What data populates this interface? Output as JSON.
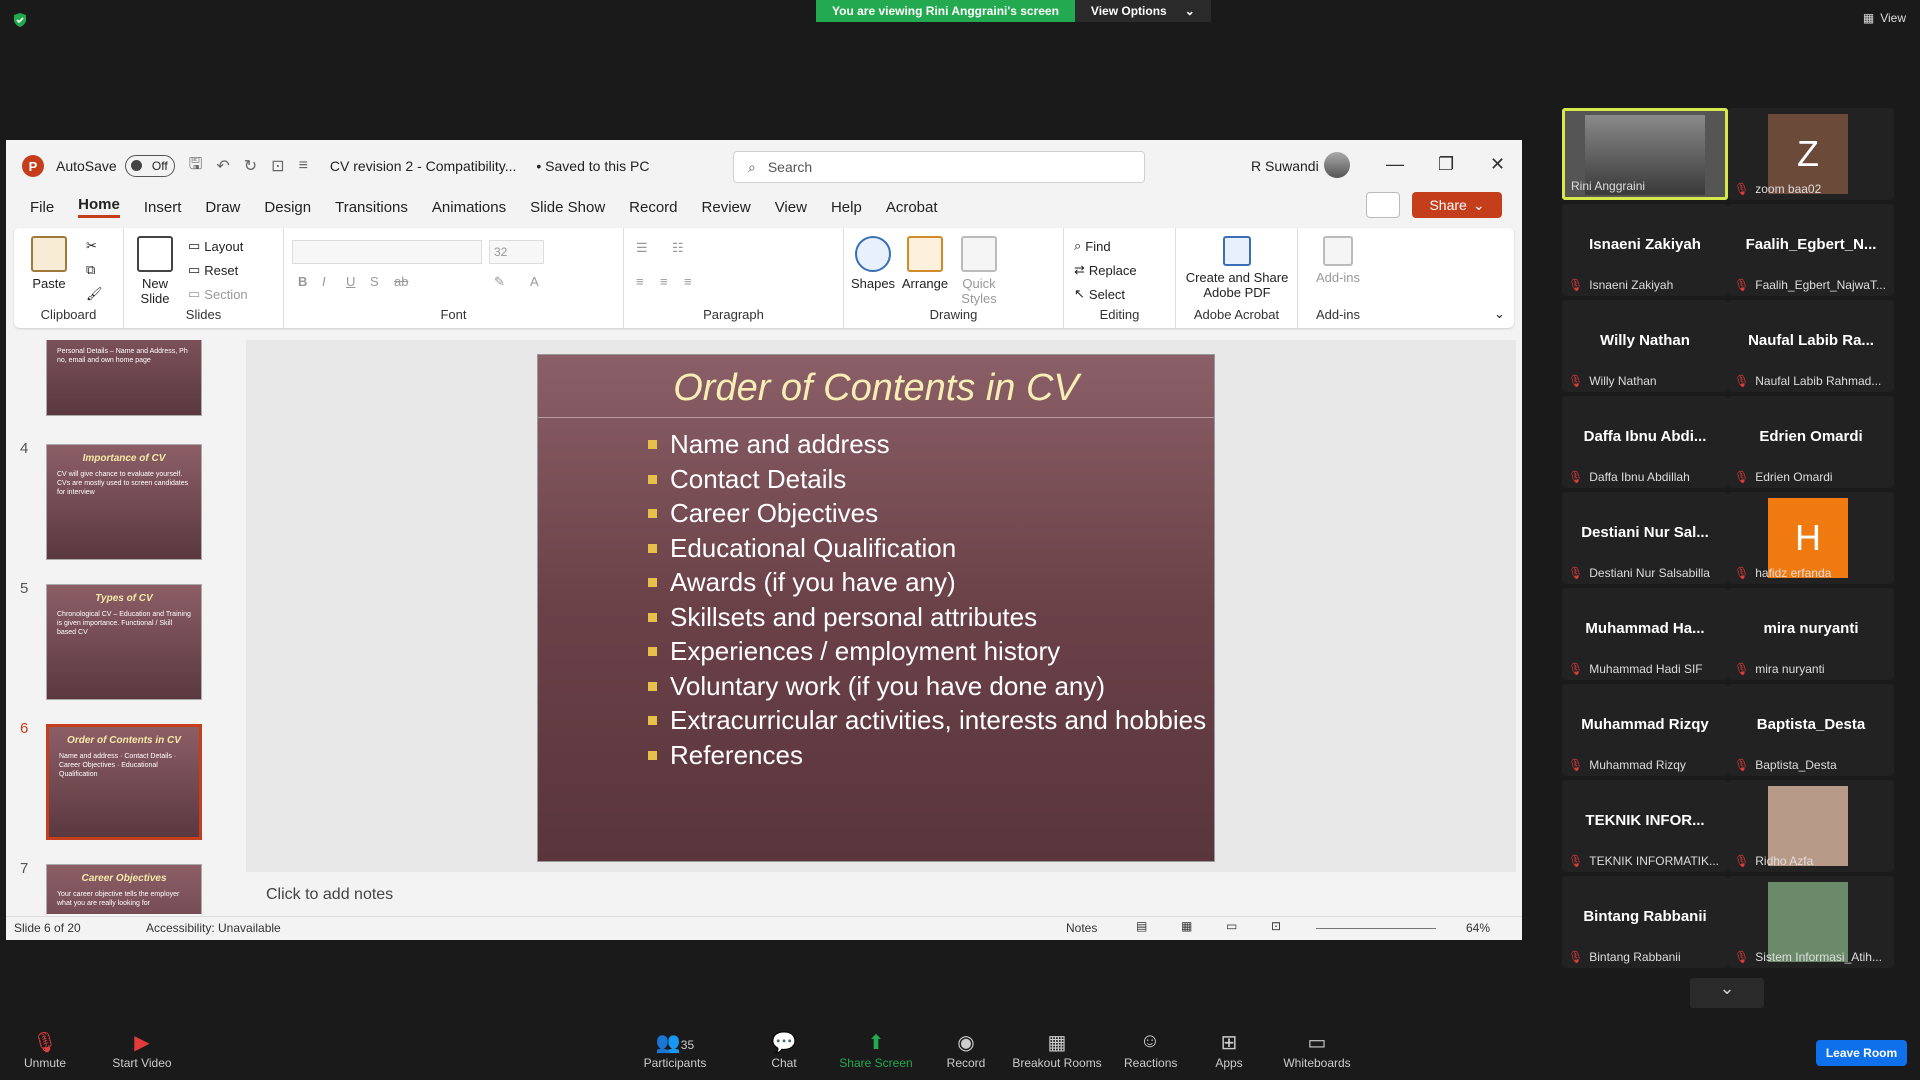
{
  "zoom": {
    "banner_text": "You are viewing Rini Anggraini's screen",
    "view_options": "View Options",
    "view_label": "View"
  },
  "ppt": {
    "autosave_label": "AutoSave",
    "autosave_state": "Off",
    "doc_title": "CV revision 2 - Compatibility...",
    "saved_state": "• Saved to this PC",
    "search_placeholder": "Search",
    "user_name": "R Suwandi",
    "menu": [
      "File",
      "Home",
      "Insert",
      "Draw",
      "Design",
      "Transitions",
      "Animations",
      "Slide Show",
      "Record",
      "Review",
      "View",
      "Help",
      "Acrobat"
    ],
    "share_label": "Share",
    "ribbon": {
      "clipboard": "Clipboard",
      "paste": "Paste",
      "slides": "Slides",
      "new_slide": "New Slide",
      "layout": "Layout",
      "reset": "Reset",
      "section": "Section",
      "font": "Font",
      "font_size": "32",
      "paragraph": "Paragraph",
      "drawing": "Drawing",
      "shapes": "Shapes",
      "arrange": "Arrange",
      "quick_styles": "Quick Styles",
      "editing": "Editing",
      "find": "Find",
      "replace": "Replace",
      "select": "Select",
      "acrobat_group": "Adobe Acrobat",
      "create_share": "Create and Share Adobe PDF",
      "addins_group": "Add-ins",
      "addins": "Add-ins"
    },
    "thumbs": [
      {
        "num": "",
        "title": "",
        "text": "Personal Details – Name and Address, Ph no, email and own home page"
      },
      {
        "num": "4",
        "title": "Importance of CV",
        "text": "CV will give chance to evaluate yourself. CVs are mostly used to screen candidates for interview"
      },
      {
        "num": "5",
        "title": "Types of CV",
        "text": "Chronological CV – Education and Training is given importance. Functional / Skill based CV"
      },
      {
        "num": "6",
        "title": "Order of Contents in CV",
        "text": "Name and address · Contact Details · Career Objectives · Educational Qualification"
      },
      {
        "num": "7",
        "title": "Career Objectives",
        "text": "Your career objective tells the employer what you are really looking for"
      }
    ],
    "slide": {
      "title": "Order of Contents in CV",
      "bullets": [
        "Name and address",
        "Contact Details",
        "Career Objectives",
        "Educational Qualification",
        "Awards (if you have any)",
        "Skillsets and personal attributes",
        "Experiences / employment history",
        "Voluntary work (if you have done any)",
        "Extracurricular activities, interests and hobbies",
        "References"
      ]
    },
    "notes_placeholder": "Click to add notes",
    "status": {
      "slide_of": "Slide 6 of 20",
      "accessibility": "Accessibility: Unavailable",
      "notes": "Notes",
      "zoom": "64%"
    }
  },
  "participants": [
    {
      "big": "",
      "label": "Rini Anggraini",
      "type": "video"
    },
    {
      "big": "Z",
      "label": "zoom baa02",
      "type": "avatar",
      "color": "#6b4a3a"
    },
    {
      "big": "Isnaeni Zakiyah",
      "label": "Isnaeni Zakiyah",
      "type": "name"
    },
    {
      "big": "Faalih_Egbert_N...",
      "label": "Faalih_Egbert_NajwaT...",
      "type": "name"
    },
    {
      "big": "Willy Nathan",
      "label": "Willy Nathan",
      "type": "name"
    },
    {
      "big": "Naufal Labib Ra...",
      "label": "Naufal Labib Rahmad...",
      "type": "name"
    },
    {
      "big": "Daffa Ibnu Abdi...",
      "label": "Daffa Ibnu Abdillah",
      "type": "name"
    },
    {
      "big": "Edrien Omardi",
      "label": "Edrien Omardi",
      "type": "name"
    },
    {
      "big": "Destiani Nur Sal...",
      "label": "Destiani Nur Salsabilla",
      "type": "name"
    },
    {
      "big": "H",
      "label": "hafidz erfanda",
      "type": "avatar",
      "color": "#f07a10"
    },
    {
      "big": "Muhammad Ha...",
      "label": "Muhammad Hadi SIF",
      "type": "name"
    },
    {
      "big": "mira nuryanti",
      "label": "mira nuryanti",
      "type": "name"
    },
    {
      "big": "Muhammad Rizqy",
      "label": "Muhammad Rizqy",
      "type": "name"
    },
    {
      "big": "Baptista_Desta",
      "label": "Baptista_Desta",
      "type": "name"
    },
    {
      "big": "TEKNIK INFOR...",
      "label": "TEKNIK INFORMATIK...",
      "type": "name"
    },
    {
      "big": "",
      "label": "Ridho Azfa",
      "type": "photo",
      "color": "#b89a88"
    },
    {
      "big": "Bintang Rabbanii",
      "label": "Bintang Rabbanii",
      "type": "name"
    },
    {
      "big": "",
      "label": "Sistem Informasi_Atih...",
      "type": "photo",
      "color": "#6a8a6a"
    }
  ],
  "toolbar": {
    "unmute": "Unmute",
    "start_video": "Start Video",
    "participants": "Participants",
    "participants_count": "35",
    "chat": "Chat",
    "share_screen": "Share Screen",
    "record": "Record",
    "breakout": "Breakout Rooms",
    "reactions": "Reactions",
    "apps": "Apps",
    "whiteboards": "Whiteboards",
    "leave": "Leave Room"
  }
}
